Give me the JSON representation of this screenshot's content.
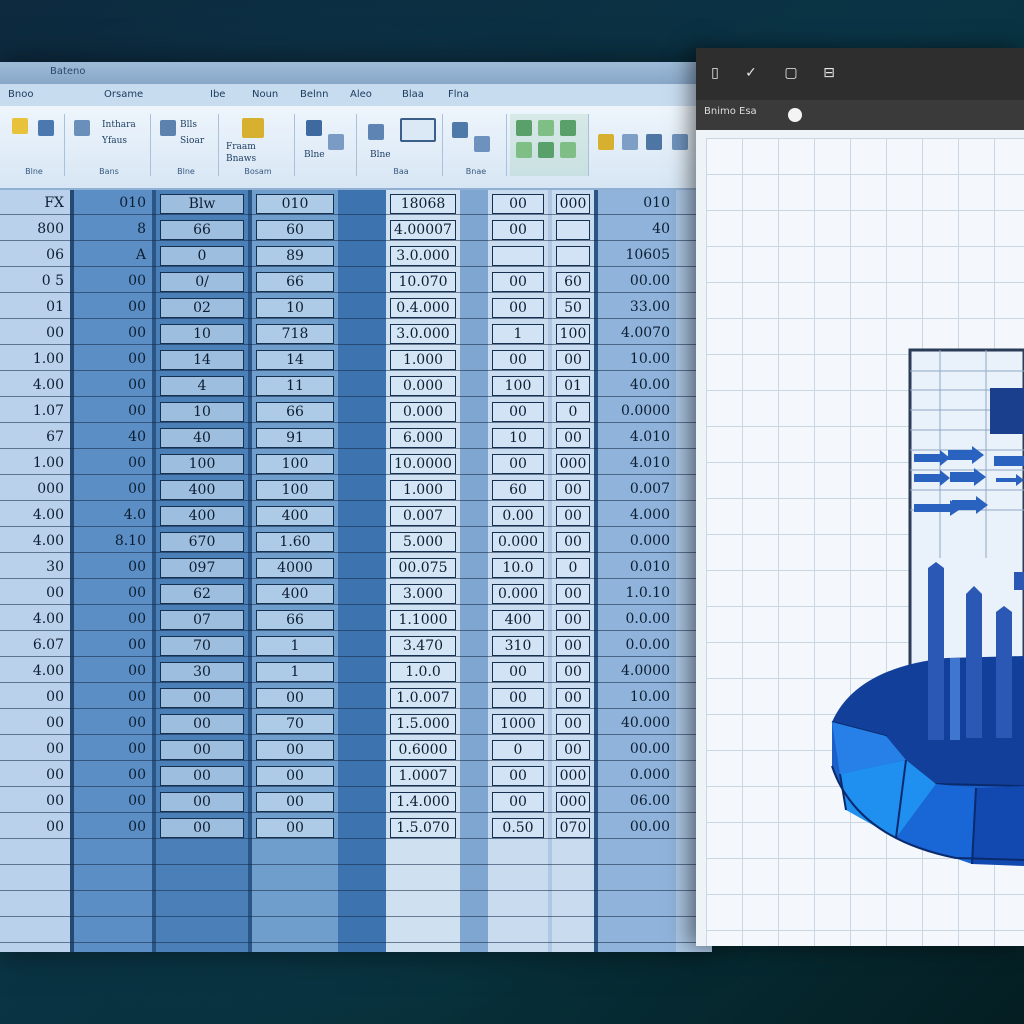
{
  "sheet": {
    "title": "Bateno",
    "ribbon_tabs": [
      "Bnoo",
      "Orsame",
      "Ibe",
      "Noun",
      "Belnn",
      "Aleo",
      "Blaa",
      "Flna"
    ],
    "ribbon_groups": [
      {
        "label": "Blne",
        "lines": [
          "Inthara",
          "Yfaus"
        ]
      },
      {
        "label": "Bans",
        "lines": [
          "Blls",
          "Sioar"
        ]
      },
      {
        "label": "Blne",
        "lines": [
          "Fraam",
          "Bnaws"
        ]
      },
      {
        "label": "Bosam",
        "lines": [
          "Blne"
        ]
      },
      {
        "label": "Baa",
        "lines": [
          "Blne"
        ]
      },
      {
        "label": "Bnae",
        "lines": [
          "Blne"
        ]
      }
    ],
    "columns": [
      {
        "cells": [
          "FX",
          "800",
          "06",
          "0 5",
          "01",
          "00",
          "1.00",
          "4.00",
          "1.07",
          "67",
          "1.00",
          "000",
          "4.00",
          "4.00",
          "30",
          "00",
          "4.00",
          "6.07",
          "4.00",
          "00",
          "00",
          "00",
          "00",
          "00",
          "00"
        ]
      },
      {
        "cells": [
          "010",
          "8",
          "A",
          "00",
          "00",
          "00",
          "00",
          "00",
          "00",
          "40",
          "00",
          "00",
          "4.0",
          "8.10",
          "00",
          "00",
          "00",
          "00",
          "00",
          "00",
          "00",
          "00",
          "00",
          "00",
          "00"
        ]
      },
      {
        "cells": [
          "Blw",
          "66",
          "0",
          "0/",
          "02",
          "10",
          "14",
          "4",
          "10",
          "40",
          "100",
          "400",
          "400",
          "670",
          "097",
          "62",
          "07",
          "70",
          "30",
          "00",
          "00",
          "00",
          "00",
          "00",
          "00"
        ]
      },
      {
        "cells": [
          "010",
          "60",
          "89",
          "66",
          "10",
          "718",
          "14",
          "11",
          "66",
          "91",
          "100",
          "100",
          "400",
          "1.60",
          "4000",
          "400",
          "66",
          "1",
          "1",
          "00",
          "70",
          "00",
          "00",
          "00",
          "00"
        ]
      },
      {
        "cells": [
          "18068",
          "4.00007",
          "3.0.000",
          "10.070",
          "0.4.000",
          "3.0.000",
          "1.000",
          "0.000",
          "0.000",
          "6.000",
          "10.0000",
          "1.000",
          "0.007",
          "5.000",
          "00.075",
          "3.000",
          "1.1000",
          "3.470",
          "1.0.0",
          "1.0.007",
          "1.5.000",
          "0.6000",
          "1.0007",
          "1.4.000",
          "1.5.070"
        ]
      },
      {
        "cells": [
          "00",
          "00",
          "",
          "00",
          "00",
          "1",
          "00",
          "100",
          "00",
          "10",
          "00",
          "60",
          "0.00",
          "0.000",
          "10.0",
          "0.000",
          "400",
          "310",
          "00",
          "00",
          "1000",
          "0",
          "00",
          "00",
          "0.50"
        ]
      },
      {
        "cells": [
          "000",
          "",
          "",
          "60",
          "50",
          "100",
          "00",
          "01",
          "0",
          "00",
          "000",
          "00",
          "00",
          "00",
          "0",
          "00",
          "00",
          "00",
          "00",
          "00",
          "00",
          "00",
          "000",
          "000",
          "070"
        ]
      },
      {
        "cells": [
          "010",
          "40",
          "10605",
          "00.00",
          "33.00",
          "4.0070",
          "10.00",
          "40.00",
          "0.0000",
          "4.010",
          "4.010",
          "0.007",
          "4.000",
          "0.000",
          "0.010",
          "1.0.10",
          "0.0.00",
          "0.0.00",
          "4.0000",
          "10.00",
          "40.000",
          "00.00",
          "0.000",
          "06.00",
          "00.00"
        ]
      }
    ]
  },
  "chart_window": {
    "toolbar_icons": [
      "mobile-icon",
      "check-icon",
      "page-icon",
      "save-icon"
    ],
    "tab_label": "Bnimo Esa"
  },
  "colors": {
    "sheet_dark_column": "#4a7fb8",
    "sheet_light_column": "#b9d1ea",
    "bar_blue": "#2b57b5",
    "donut_light": "#1f8ff0",
    "donut_dark": "#1249b0",
    "arrow_blue": "#2a63bf"
  }
}
